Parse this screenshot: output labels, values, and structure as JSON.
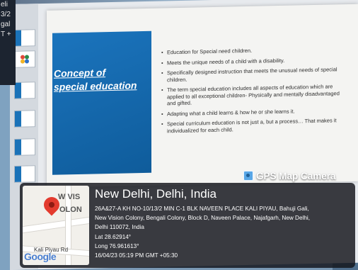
{
  "inset": {
    "lines": [
      "eli",
      "3/2",
      "gal",
      "",
      "",
      "T +"
    ]
  },
  "slide": {
    "title": "Concept of special education",
    "bullets": [
      "Education for Special need children.",
      "Meets the unique needs of a child with a disability.",
      "Specifically designed instruction that meets the unusual needs of special children.",
      "The term special education includes all aspects of education which are applied to all exceptional children- Physically and mentally disadvantaged and gifted.",
      "Adapting what a child learns & how he or she learns it.",
      "Special curriculum education is not just a, but a process… That makes it individualized for each child."
    ]
  },
  "stamp": {
    "brand": "GPS Map Camera",
    "map": {
      "label_top": "W VIS",
      "label_mid": "OLON",
      "street": "Kali Piyau Rd",
      "google": "Google"
    },
    "place": "New Delhi, Delhi, India",
    "address_lines": [
      "26A&27-A KH NO-10/13/2 MIN C-1 BLK NAVEEN PLACE KALI PIYAU, Bahuji Gali,",
      "New Vision Colony, Bengali Colony, Block D, Naveen Palace, Najafgarh, New Delhi,",
      "Delhi 110072, India"
    ],
    "lat": "Lat 28.62914°",
    "long": "Long 76.961613°",
    "datetime": "16/04/23 05:19 PM GMT +05:30"
  }
}
